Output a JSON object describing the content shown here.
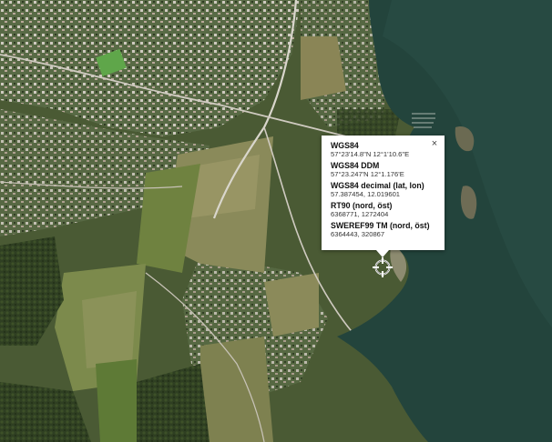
{
  "map": {
    "type": "satellite",
    "icons": {
      "marker": "crosshair-target-icon",
      "close": "close-icon"
    }
  },
  "popup": {
    "close_glyph": "×",
    "rows": [
      {
        "label": "WGS84",
        "value": "57°23'14.8\"N 12°1'10.6\"E"
      },
      {
        "label": "WGS84 DDM",
        "value": "57°23.247'N 12°1.176'E"
      },
      {
        "label": "WGS84 decimal (lat, lon)",
        "value": "57.387454, 12.019601"
      },
      {
        "label": "RT90 (nord, öst)",
        "value": "6368771, 1272404"
      },
      {
        "label": "SWEREF99 TM (nord, öst)",
        "value": "6364443, 320867"
      }
    ]
  }
}
